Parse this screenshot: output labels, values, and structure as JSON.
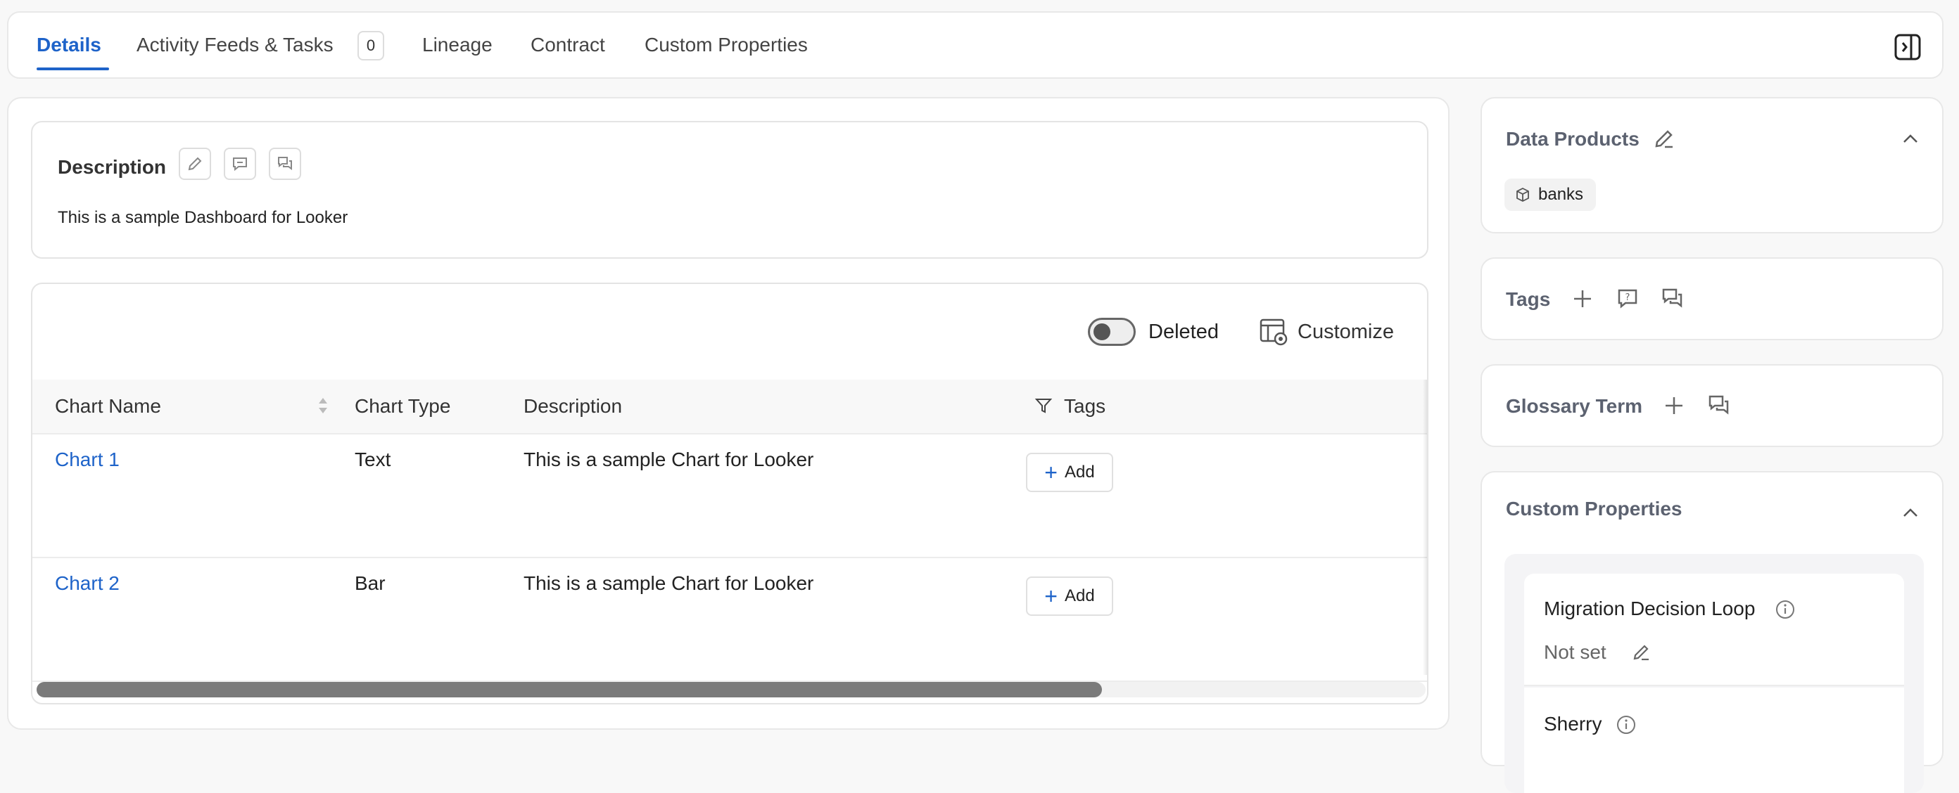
{
  "tabs": [
    {
      "label": "Details"
    },
    {
      "label": "Activity Feeds & Tasks",
      "count": "0"
    },
    {
      "label": "Lineage"
    },
    {
      "label": "Contract"
    },
    {
      "label": "Custom Properties"
    }
  ],
  "description": {
    "title": "Description",
    "text": "This is a sample Dashboard for Looker"
  },
  "table": {
    "deleted_toggle_label": "Deleted",
    "customize_label": "Customize",
    "columns": [
      "Chart Name",
      "Chart Type",
      "Description",
      "Tags"
    ],
    "rows": [
      {
        "name": "Chart 1",
        "type": "Text",
        "description": "This is a sample Chart for Looker",
        "add_label": "Add"
      },
      {
        "name": "Chart 2",
        "type": "Bar",
        "description": "This is a sample Chart for Looker",
        "add_label": "Add"
      }
    ]
  },
  "sidebar": {
    "data_products": {
      "title": "Data Products",
      "items": [
        "banks"
      ]
    },
    "tags": {
      "title": "Tags"
    },
    "glossary": {
      "title": "Glossary Term"
    },
    "custom_properties": {
      "title": "Custom Properties",
      "items": [
        {
          "name": "Migration Decision Loop",
          "value": "Not set"
        },
        {
          "name": "Sherry"
        }
      ]
    }
  },
  "colors": {
    "accent": "#1e63c9",
    "muted_title": "#5c6270"
  }
}
